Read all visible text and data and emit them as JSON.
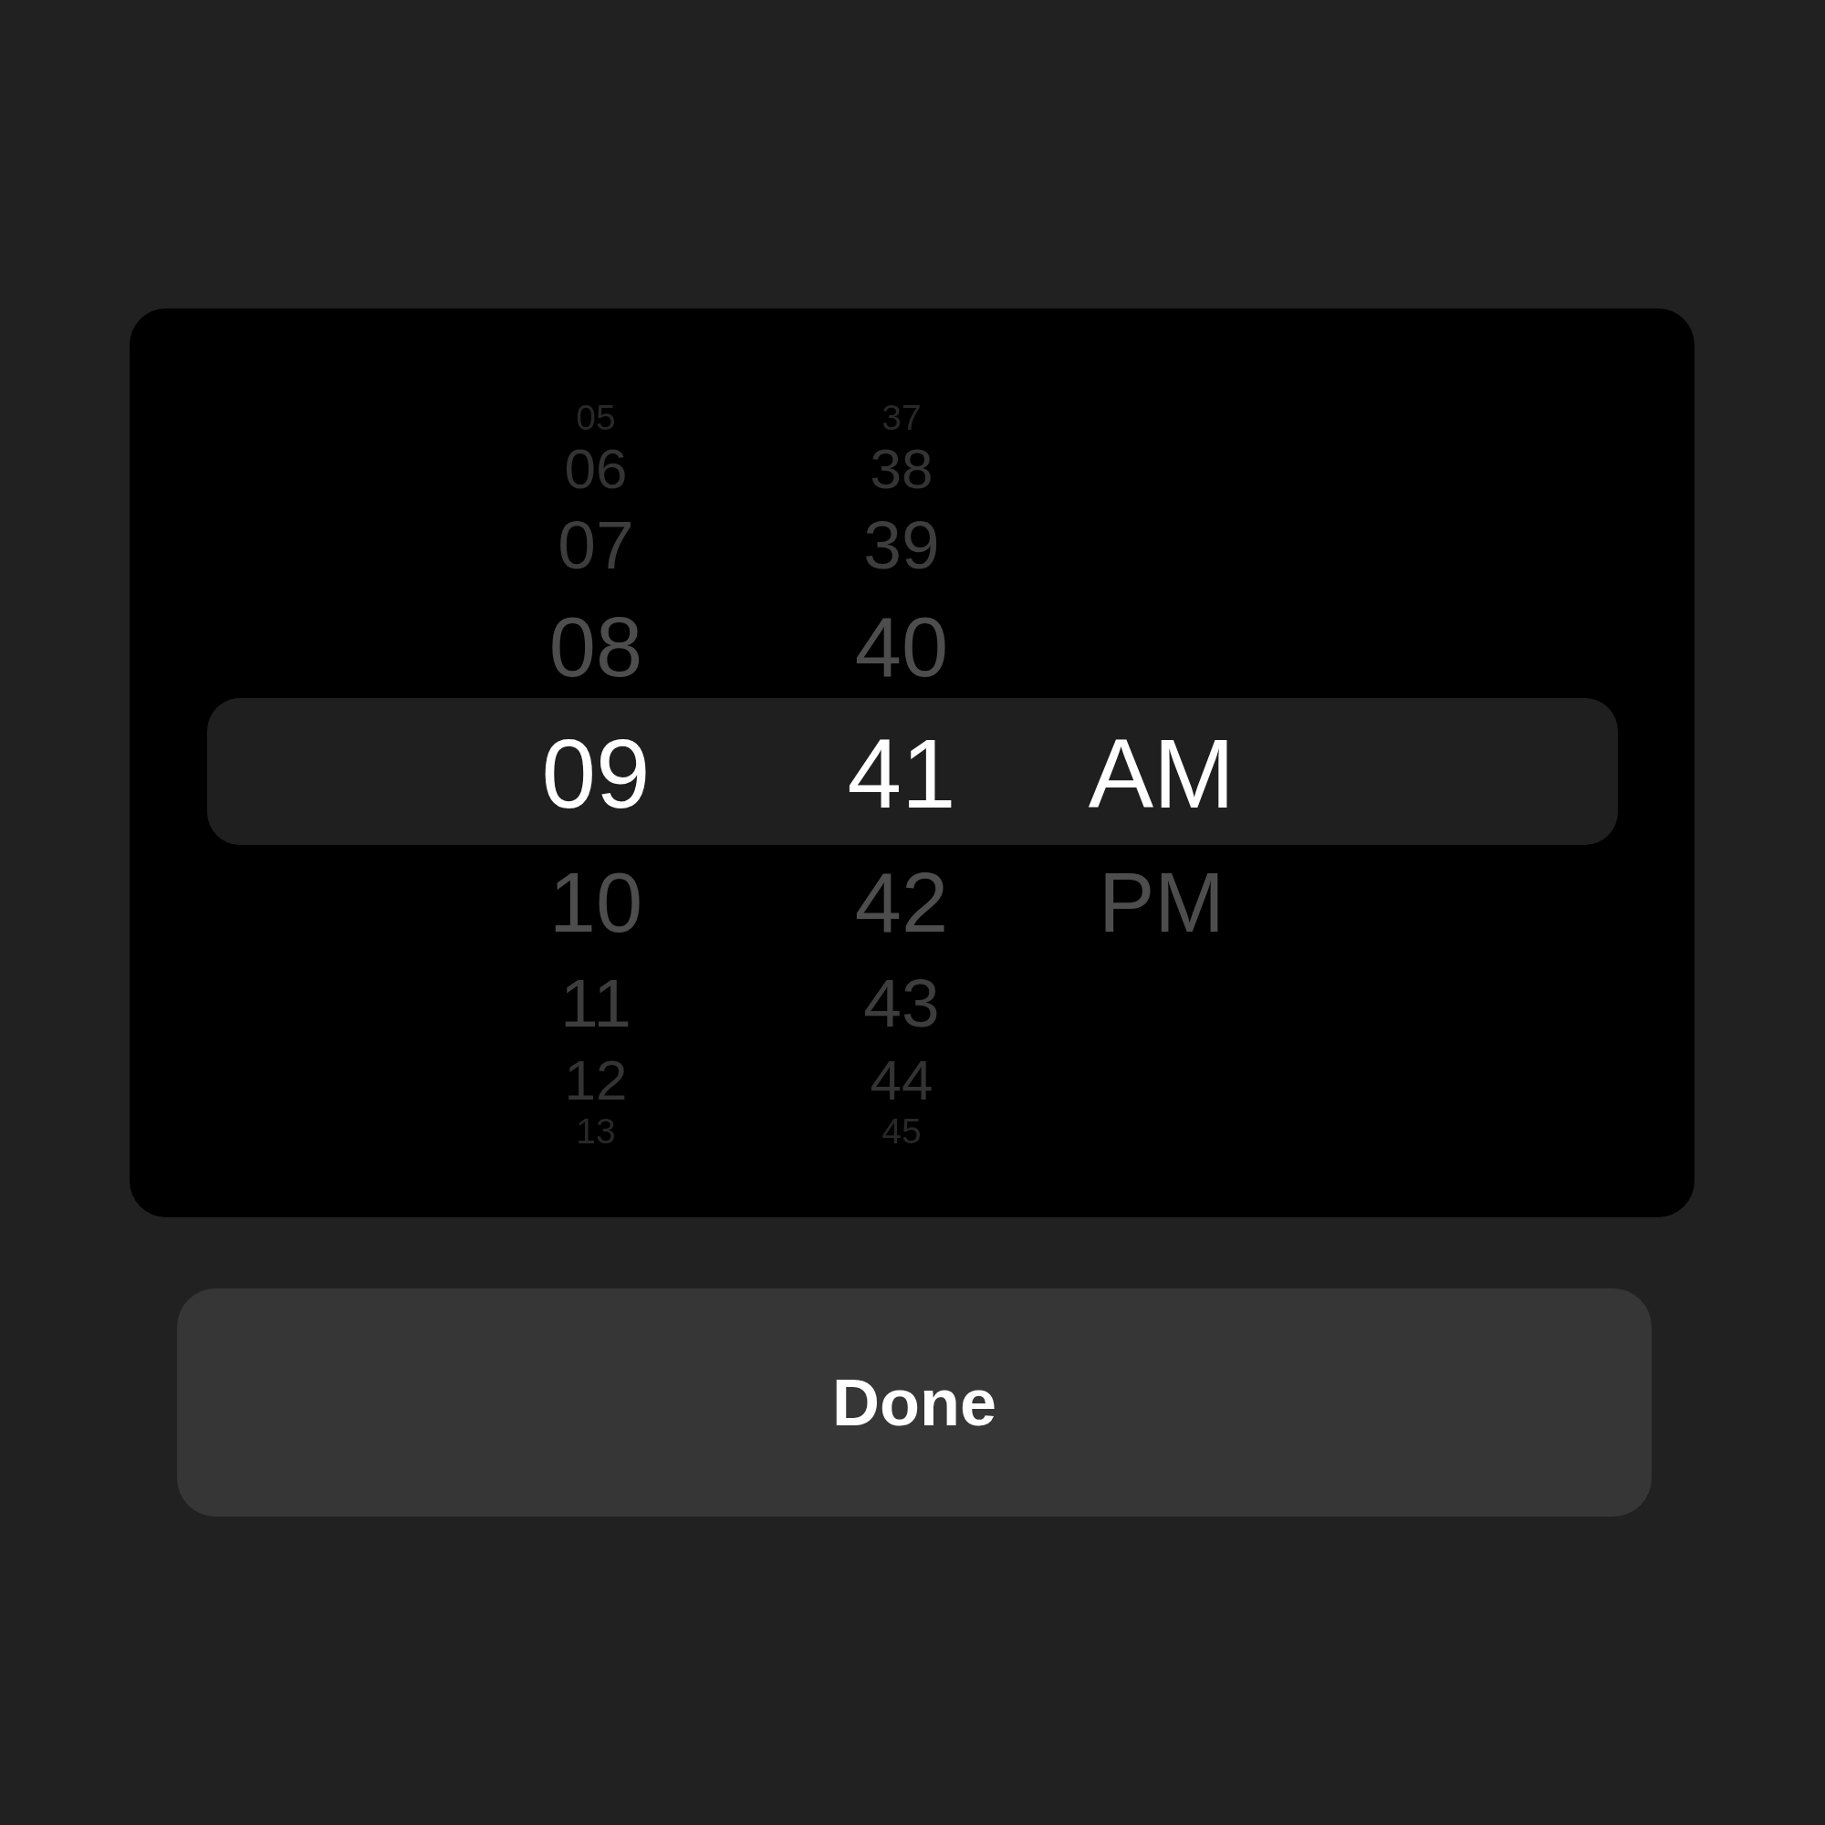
{
  "picker": {
    "columns": [
      {
        "items": [
          {
            "label": "05",
            "selected": false
          },
          {
            "label": "06",
            "selected": false
          },
          {
            "label": "07",
            "selected": false
          },
          {
            "label": "08",
            "selected": false
          },
          {
            "label": "09",
            "selected": true
          },
          {
            "label": "10",
            "selected": false
          },
          {
            "label": "11",
            "selected": false
          },
          {
            "label": "12",
            "selected": false
          },
          {
            "label": "13",
            "selected": false
          }
        ]
      },
      {
        "items": [
          {
            "label": "37",
            "selected": false
          },
          {
            "label": "38",
            "selected": false
          },
          {
            "label": "39",
            "selected": false
          },
          {
            "label": "40",
            "selected": false
          },
          {
            "label": "41",
            "selected": true
          },
          {
            "label": "42",
            "selected": false
          },
          {
            "label": "43",
            "selected": false
          },
          {
            "label": "44",
            "selected": false
          },
          {
            "label": "45",
            "selected": false
          }
        ]
      },
      {
        "items": [
          {
            "label": "AM",
            "selected": true
          },
          {
            "label": "PM",
            "selected": false
          }
        ]
      }
    ]
  },
  "done_button": {
    "label": "Done"
  }
}
